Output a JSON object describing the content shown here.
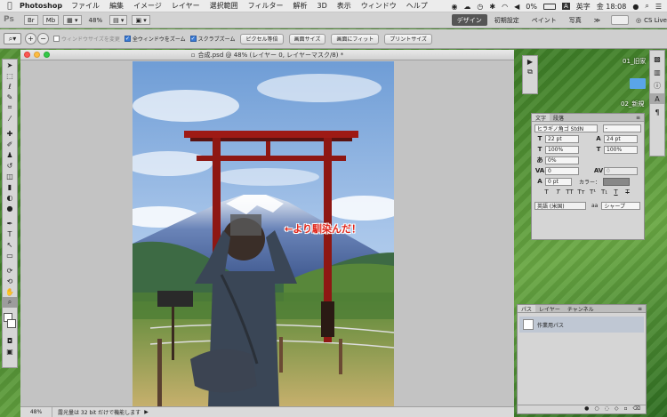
{
  "menubar": {
    "app_name": "Photoshop",
    "items": [
      "ファイル",
      "編集",
      "イメージ",
      "レイヤー",
      "選択範囲",
      "フィルター",
      "解析",
      "3D",
      "表示",
      "ウィンドウ",
      "ヘルプ"
    ],
    "battery": "0%",
    "ime": "A",
    "ime_label": "英字",
    "clock": "金 18:08"
  },
  "appbar": {
    "logo": "Ps",
    "br": "Br",
    "mb": "Mb",
    "zoom": "48%",
    "workspaces": [
      "デザイン",
      "初期設定",
      "ペイント",
      "写真"
    ],
    "more": "≫",
    "cslive": "CS Live"
  },
  "options": {
    "resize_windows": "ウィンドウサイズを変更",
    "zoom_all": "全ウィンドウをズーム",
    "scrubby_zoom": "スクラブズーム",
    "btn_actual_pixels": "ピクセル等倍",
    "btn_fit_screen": "画面サイズ",
    "btn_fill_screen": "画面にフィット",
    "btn_print_size": "プリントサイズ"
  },
  "document": {
    "title": "合成.psd @ 48% (レイヤー 0, レイヤーマスク/8) *",
    "overlay_text": "←より馴染んだ！",
    "status_zoom": "48%",
    "status_info": "露光量は 32 bit だけで機能します"
  },
  "character_panel": {
    "tab_char": "文字",
    "tab_para": "段落",
    "font": "ヒラギノ角ゴ StdN",
    "font_style": "-",
    "size": "22 pt",
    "leading": "24 pt",
    "vscale": "100%",
    "hscale": "100%",
    "tsume": "0%",
    "tracking": "0",
    "kerning": "0",
    "baseline": "0 pt",
    "color_label": "カラー：",
    "language": "英語 (米国)",
    "aa_label": "aa",
    "antialias": "シャープ"
  },
  "paths_panel": {
    "tabs": [
      "パス",
      "レイヤー",
      "チャンネル"
    ],
    "item": "作業用パス"
  },
  "desktop": {
    "file1": "01_旧家",
    "file2": "02_新規"
  }
}
